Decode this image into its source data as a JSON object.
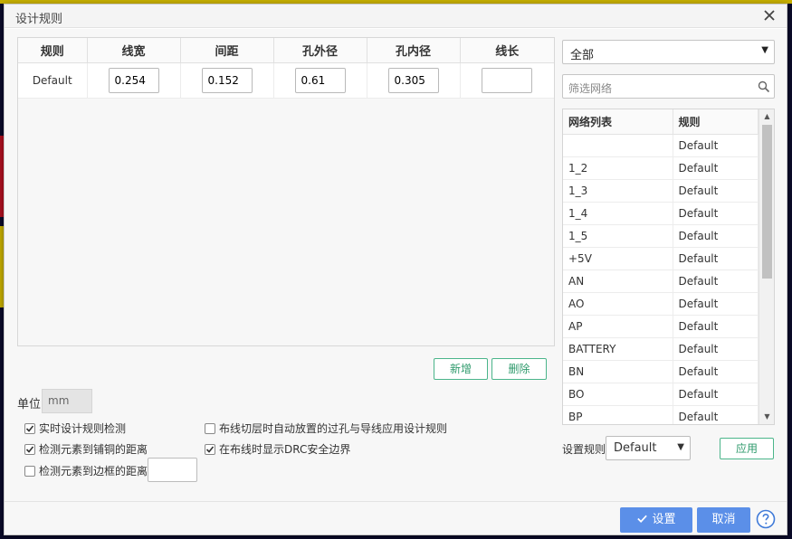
{
  "dialog": {
    "title": "设计规则"
  },
  "rules_table": {
    "headers": [
      "规则",
      "线宽",
      "间距",
      "孔外径",
      "孔内径",
      "线长"
    ],
    "rows": [
      {
        "name": "Default",
        "track_width": "0.254",
        "clearance": "0.152",
        "via_outer": "0.61",
        "via_inner": "0.305",
        "track_length": ""
      }
    ]
  },
  "actions": {
    "add_label": "新增",
    "delete_label": "删除"
  },
  "unit": {
    "label": "单位",
    "value": "mm"
  },
  "options": {
    "realtime_drc": {
      "label": "实时设计规则检测",
      "checked": true
    },
    "check_copper": {
      "label": "检测元素到铺铜的距离",
      "checked": true
    },
    "check_board_edge": {
      "label": "检测元素到边框的距离",
      "checked": false
    },
    "auto_via_rule": {
      "label": "布线切层时自动放置的过孔与导线应用设计规则",
      "checked": false
    },
    "show_drc_boundary": {
      "label": "在布线时显示DRC安全边界",
      "checked": true
    }
  },
  "net_panel": {
    "scope_select": "全部",
    "filter_placeholder": "筛选网络",
    "headers": [
      "网络列表",
      "规则"
    ],
    "rows": [
      [
        "",
        "Default"
      ],
      [
        "1_2",
        "Default"
      ],
      [
        "1_3",
        "Default"
      ],
      [
        "1_4",
        "Default"
      ],
      [
        "1_5",
        "Default"
      ],
      [
        "+5V",
        "Default"
      ],
      [
        "AN",
        "Default"
      ],
      [
        "AO",
        "Default"
      ],
      [
        "AP",
        "Default"
      ],
      [
        "BATTERY",
        "Default"
      ],
      [
        "BN",
        "Default"
      ],
      [
        "BO",
        "Default"
      ],
      [
        "BP",
        "Default"
      ]
    ],
    "set_rule_label": "设置规则",
    "set_rule_value": "Default",
    "apply_label": "应用"
  },
  "footer": {
    "confirm_label": "设置",
    "cancel_label": "取消"
  },
  "colors": {
    "primary": "#5b8fe8",
    "success_outline": "#4bb58a"
  }
}
